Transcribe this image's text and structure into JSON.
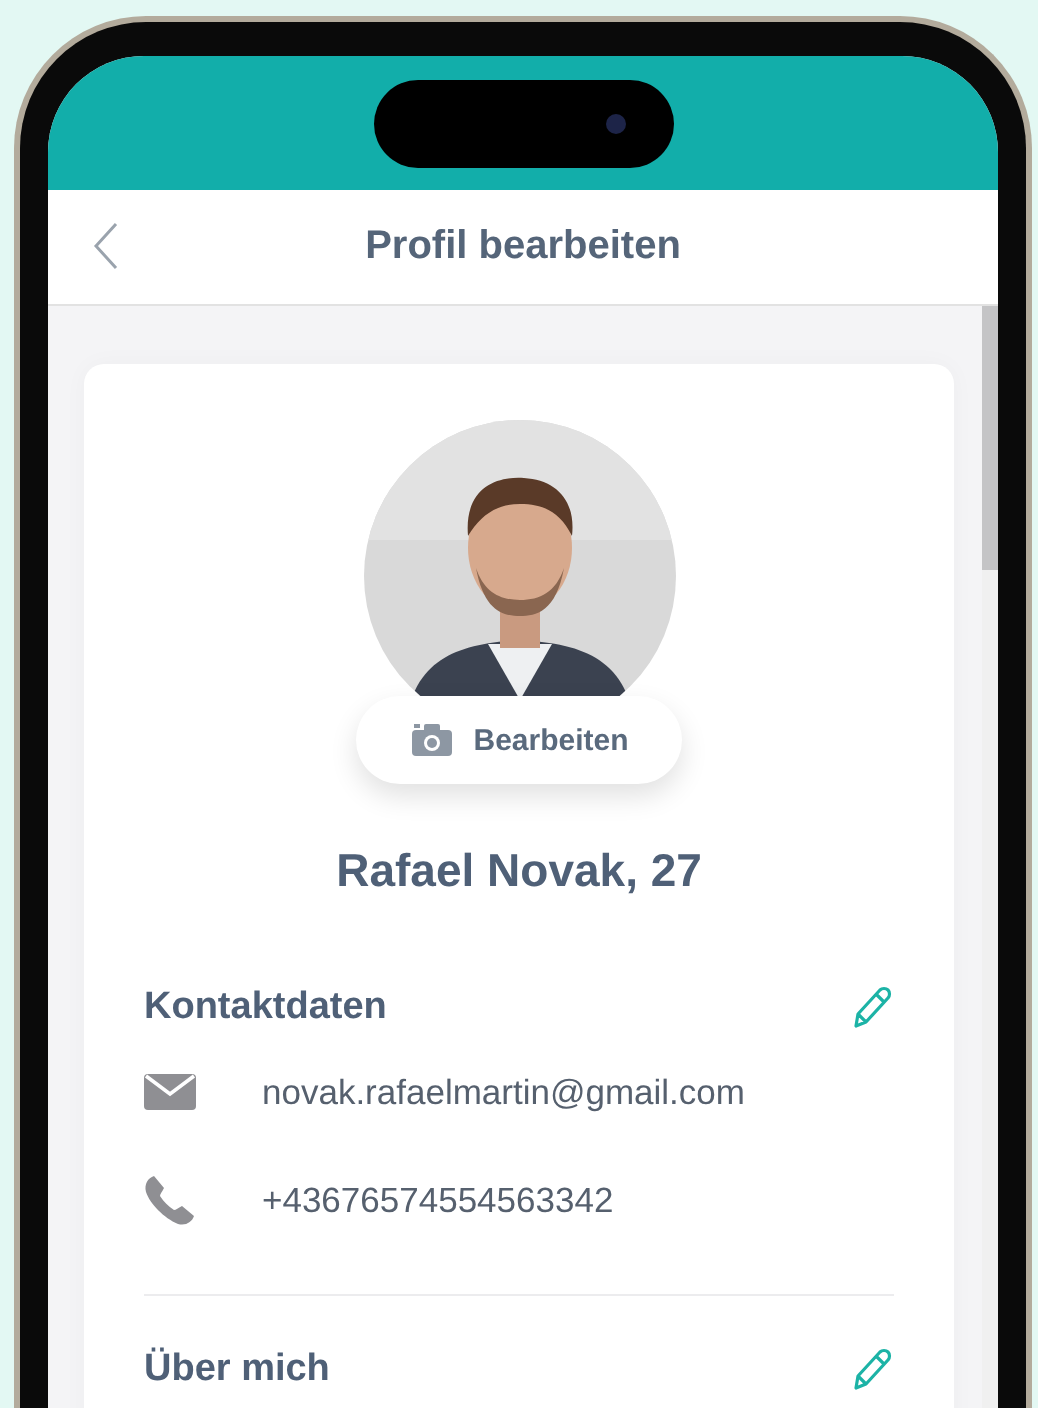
{
  "screen_title": "Profil bearbeiten",
  "profile": {
    "photo_button": "Bearbeiten",
    "name": "Rafael Novak, 27"
  },
  "sections": [
    {
      "title": "Kontaktdaten",
      "items": [
        {
          "kind": "email",
          "text": "novak.rafaelmartin@gmail.com"
        },
        {
          "kind": "phone",
          "text": "+43676574554563342"
        }
      ]
    },
    {
      "title": "Über mich"
    }
  ]
}
